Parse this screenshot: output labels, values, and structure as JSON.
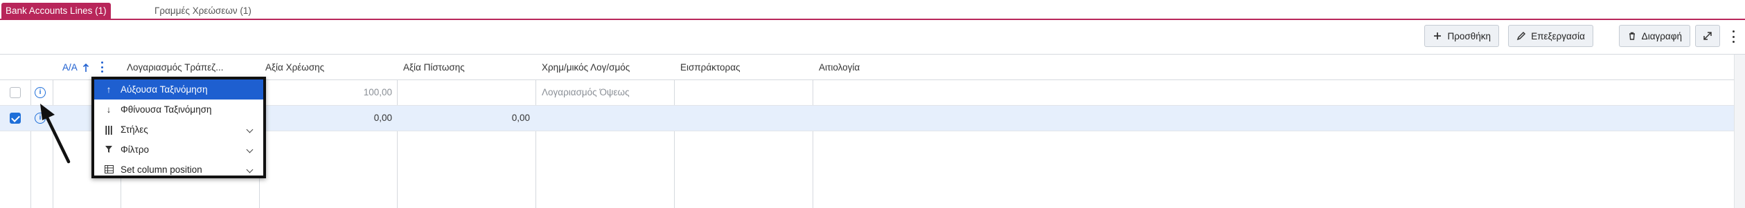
{
  "tabs": [
    {
      "label": "Bank Accounts Lines (1)",
      "active": true
    },
    {
      "label": "Γραμμές Χρεώσεων (1)",
      "active": false
    }
  ],
  "toolbar": {
    "add_label": "Προσθήκη",
    "edit_label": "Επεξεργασία",
    "delete_label": "Διαγραφή",
    "expand_icon": "expand-icon",
    "more_icon": "kebab-icon"
  },
  "grid": {
    "columns": [
      {
        "label": ""
      },
      {
        "label": ""
      },
      {
        "label": "Α/Α"
      },
      {
        "label": "Λογαριασμός Τράπεζ..."
      },
      {
        "label": "Αξία Χρέωσης"
      },
      {
        "label": "Αξία Πίστωσης"
      },
      {
        "label": "Χρημ/μικός Λογ/σμός"
      },
      {
        "label": "Εισπράκτορας"
      },
      {
        "label": "Αιτιολογία"
      }
    ],
    "rows": [
      {
        "selected": false,
        "debit": "100,00",
        "credit": "",
        "account": "Λογαριασμός Όψεως"
      },
      {
        "selected": true,
        "debit": "0,00",
        "credit": "0,00",
        "account": ""
      }
    ]
  },
  "context_menu": {
    "items": [
      {
        "label": "Αύξουσα Ταξινόμηση",
        "icon": "sort-asc-icon",
        "active": true
      },
      {
        "label": "Φθίνουσα Ταξινόμηση",
        "icon": "sort-desc-icon",
        "active": false
      },
      {
        "label": "Στήλες",
        "icon": "columns-icon",
        "active": false
      },
      {
        "label": "Φίλτρο",
        "icon": "filter-icon",
        "active": false
      },
      {
        "label": "Set column position",
        "icon": "column-position-icon",
        "active": false
      }
    ]
  },
  "colors": {
    "accent": "#b8265a",
    "primary": "#1e5fd0",
    "selected_row": "#e6effc"
  }
}
